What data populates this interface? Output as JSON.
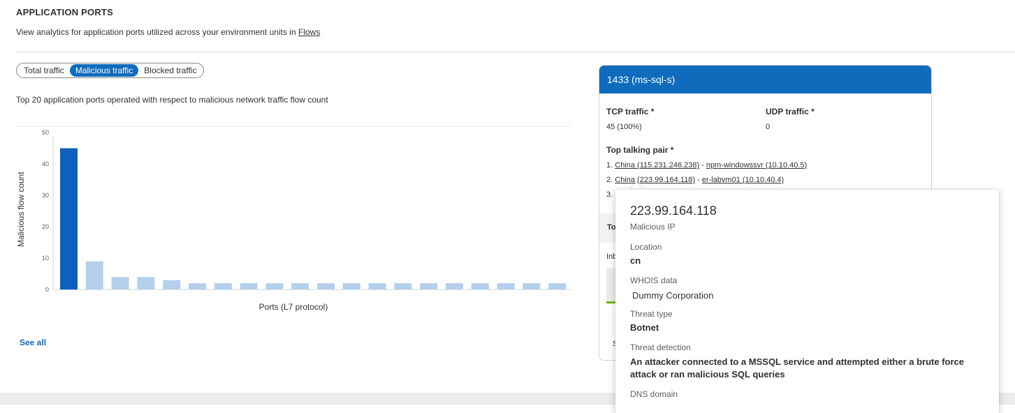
{
  "header": {
    "title": "APPLICATION PORTS",
    "subtitle_prefix": "View analytics for application ports utilized across your environment units in ",
    "subtitle_link": "Flows"
  },
  "tabs": [
    {
      "label": "Total traffic",
      "active": false
    },
    {
      "label": "Malicious traffic",
      "active": true
    },
    {
      "label": "Blocked traffic",
      "active": false
    }
  ],
  "chart_description": "Top 20 application ports operated with respect to malicious network traffic flow count",
  "chart_data": {
    "type": "bar",
    "xlabel": "Ports (L7 protocol)",
    "ylabel": "Malicious flow count",
    "ylim": [
      0,
      50
    ],
    "yticks": [
      0,
      10,
      20,
      30,
      40,
      50
    ],
    "values": [
      45,
      9,
      4,
      4,
      3,
      2,
      2,
      2,
      2,
      2,
      2,
      2,
      2,
      2,
      2,
      2,
      2,
      2,
      2,
      2
    ],
    "highlight_index": 0,
    "colors": {
      "highlight": "#0f5fbd",
      "normal": "#b4d0ec"
    }
  },
  "see_all": "See all",
  "detail_card": {
    "title": "1433 (ms-sql-s)",
    "tcp_label": "TCP traffic *",
    "tcp_value": "45 (100%)",
    "udp_label": "UDP traffic *",
    "udp_value": "0",
    "pairs_label": "Top talking pair *",
    "pairs": [
      {
        "index": "1.",
        "source": "China (115.231.246.238)",
        "sep": " - ",
        "dest": "npm-windowssvr (10.10.40.5)"
      },
      {
        "index": "2.",
        "source": "China (223.99.164.118)",
        "sep": " - ",
        "dest": "er-labvm01 (10.10.40.4)"
      },
      {
        "index": "3.",
        "source": "",
        "sep": "",
        "dest": ""
      }
    ],
    "partial_row_label": "To",
    "partial_in_label": "Inb",
    "partial_s_label": "S"
  },
  "popup": {
    "ip": "223.99.164.118",
    "ip_type": "Malicious IP",
    "location_label": "Location",
    "location_value": "cn",
    "whois_label": "WHOIS data",
    "whois_value": "Dummy Corporation",
    "threat_type_label": "Threat type",
    "threat_type_value": "Botnet",
    "threat_detection_label": "Threat detection",
    "threat_detection_value": "An attacker connected to a MSSQL service and attempted either a brute force attack or ran malicious SQL queries",
    "dns_label": "DNS domain"
  }
}
